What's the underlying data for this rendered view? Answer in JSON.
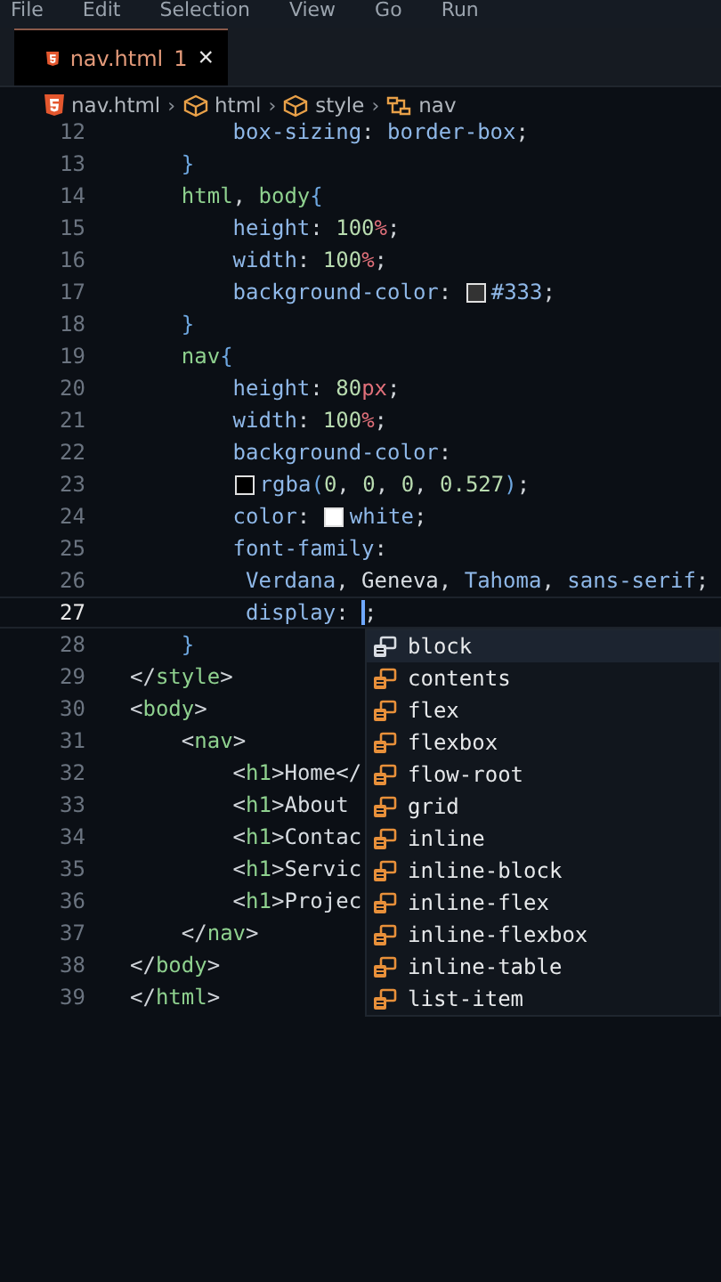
{
  "menu": [
    "File",
    "Edit",
    "Selection",
    "View",
    "Go",
    "Run"
  ],
  "tab": {
    "name": "nav.html",
    "problems": "1",
    "close": "×"
  },
  "breadcrumb_separator": "›",
  "breadcrumb": [
    {
      "label": "nav.html",
      "kind": "file"
    },
    {
      "label": "html",
      "kind": "element"
    },
    {
      "label": "style",
      "kind": "element"
    },
    {
      "label": "nav",
      "kind": "selector"
    }
  ],
  "code_lines": [
    {
      "number": "12",
      "current": false,
      "tokens": [
        {
          "text": "        box-sizing",
          "kind": "prop"
        },
        {
          "text": ": ",
          "kind": "punct"
        },
        {
          "text": "border-box",
          "kind": "value"
        },
        {
          "text": ";",
          "kind": "punct"
        }
      ]
    },
    {
      "number": "13",
      "current": false,
      "tokens": [
        {
          "text": "    }",
          "kind": "bracket"
        }
      ]
    },
    {
      "number": "14",
      "current": false,
      "tokens": [
        {
          "text": "    html",
          "kind": "tag"
        },
        {
          "text": ", ",
          "kind": "punct"
        },
        {
          "text": "body",
          "kind": "tag"
        },
        {
          "text": "{",
          "kind": "bracket"
        }
      ]
    },
    {
      "number": "15",
      "current": false,
      "tokens": [
        {
          "text": "        height",
          "kind": "prop"
        },
        {
          "text": ": ",
          "kind": "punct"
        },
        {
          "text": "100",
          "kind": "num"
        },
        {
          "text": "%",
          "kind": "unit"
        },
        {
          "text": ";",
          "kind": "punct"
        }
      ]
    },
    {
      "number": "16",
      "current": false,
      "tokens": [
        {
          "text": "        width",
          "kind": "prop"
        },
        {
          "text": ": ",
          "kind": "punct"
        },
        {
          "text": "100",
          "kind": "num"
        },
        {
          "text": "%",
          "kind": "unit"
        },
        {
          "text": ";",
          "kind": "punct"
        }
      ]
    },
    {
      "number": "17",
      "current": false,
      "tokens": [
        {
          "text": "        background-color",
          "kind": "prop"
        },
        {
          "text": ": ",
          "kind": "punct"
        },
        {
          "kind": "swatch",
          "color": "#333333"
        },
        {
          "text": "#333",
          "kind": "value"
        },
        {
          "text": ";",
          "kind": "punct"
        }
      ]
    },
    {
      "number": "18",
      "current": false,
      "tokens": [
        {
          "text": "    }",
          "kind": "bracket"
        }
      ]
    },
    {
      "number": "19",
      "current": false,
      "tokens": [
        {
          "text": "    nav",
          "kind": "tag"
        },
        {
          "text": "{",
          "kind": "bracket"
        }
      ]
    },
    {
      "number": "20",
      "current": false,
      "tokens": [
        {
          "text": "        height",
          "kind": "prop"
        },
        {
          "text": ": ",
          "kind": "punct"
        },
        {
          "text": "80",
          "kind": "num"
        },
        {
          "text": "px",
          "kind": "unit"
        },
        {
          "text": ";",
          "kind": "punct"
        }
      ]
    },
    {
      "number": "21",
      "current": false,
      "tokens": [
        {
          "text": "        width",
          "kind": "prop"
        },
        {
          "text": ": ",
          "kind": "punct"
        },
        {
          "text": "100",
          "kind": "num"
        },
        {
          "text": "%",
          "kind": "unit"
        },
        {
          "text": ";",
          "kind": "punct"
        }
      ]
    },
    {
      "number": "22",
      "current": false,
      "tokens": [
        {
          "text": "        background-color",
          "kind": "prop"
        },
        {
          "text": ":",
          "kind": "punct"
        }
      ]
    },
    {
      "number": "23",
      "current": false,
      "tokens": [
        {
          "kind": "swatch",
          "color": "#000000"
        },
        {
          "text": "rgba",
          "kind": "value"
        },
        {
          "text": "(",
          "kind": "bracket"
        },
        {
          "text": "0",
          "kind": "num"
        },
        {
          "text": ", ",
          "kind": "punct"
        },
        {
          "text": "0",
          "kind": "num"
        },
        {
          "text": ", ",
          "kind": "punct"
        },
        {
          "text": "0",
          "kind": "num"
        },
        {
          "text": ", ",
          "kind": "punct"
        },
        {
          "text": "0.527",
          "kind": "num"
        },
        {
          "text": ")",
          "kind": "bracket"
        },
        {
          "text": ";",
          "kind": "punct"
        }
      ]
    },
    {
      "number": "24",
      "current": false,
      "tokens": [
        {
          "text": "        color",
          "kind": "prop"
        },
        {
          "text": ": ",
          "kind": "punct"
        },
        {
          "kind": "swatch",
          "color": "#ffffff"
        },
        {
          "text": "white",
          "kind": "value"
        },
        {
          "text": ";",
          "kind": "punct"
        }
      ]
    },
    {
      "number": "25",
      "current": false,
      "tokens": [
        {
          "text": "        font-family",
          "kind": "prop"
        },
        {
          "text": ":",
          "kind": "punct"
        }
      ]
    },
    {
      "number": "26",
      "current": false,
      "tokens": [
        {
          "text": "         Verdana",
          "kind": "value"
        },
        {
          "text": ", ",
          "kind": "punct"
        },
        {
          "text": "Geneva",
          "kind": "plain"
        },
        {
          "text": ", ",
          "kind": "punct"
        },
        {
          "text": "Tahoma",
          "kind": "value"
        },
        {
          "text": ", ",
          "kind": "punct"
        },
        {
          "text": "sans-serif",
          "kind": "value"
        },
        {
          "text": ";",
          "kind": "punct"
        }
      ]
    },
    {
      "number": "27",
      "current": true,
      "tokens": [
        {
          "text": "         display",
          "kind": "prop"
        },
        {
          "text": ": ",
          "kind": "punct"
        },
        {
          "kind": "caret"
        },
        {
          "text": ";",
          "kind": "punct"
        }
      ]
    },
    {
      "number": "28",
      "current": false,
      "tokens": [
        {
          "text": "    }",
          "kind": "bracket"
        }
      ]
    },
    {
      "number": "29",
      "current": false,
      "tokens": [
        {
          "text": "</",
          "kind": "punct"
        },
        {
          "text": "style",
          "kind": "tag"
        },
        {
          "text": ">",
          "kind": "punct"
        }
      ]
    },
    {
      "number": "30",
      "current": false,
      "tokens": [
        {
          "text": "<",
          "kind": "punct"
        },
        {
          "text": "body",
          "kind": "tag"
        },
        {
          "text": ">",
          "kind": "punct"
        }
      ]
    },
    {
      "number": "31",
      "current": false,
      "tokens": [
        {
          "text": "    <",
          "kind": "punct"
        },
        {
          "text": "nav",
          "kind": "tag"
        },
        {
          "text": ">",
          "kind": "punct"
        }
      ]
    },
    {
      "number": "32",
      "current": false,
      "tokens": [
        {
          "text": "        <",
          "kind": "punct"
        },
        {
          "text": "h1",
          "kind": "tag"
        },
        {
          "text": ">",
          "kind": "punct"
        },
        {
          "text": "Home</",
          "kind": "plain"
        }
      ]
    },
    {
      "number": "33",
      "current": false,
      "tokens": [
        {
          "text": "        <",
          "kind": "punct"
        },
        {
          "text": "h1",
          "kind": "tag"
        },
        {
          "text": ">",
          "kind": "punct"
        },
        {
          "text": "About",
          "kind": "plain"
        }
      ]
    },
    {
      "number": "34",
      "current": false,
      "tokens": [
        {
          "text": "        <",
          "kind": "punct"
        },
        {
          "text": "h1",
          "kind": "tag"
        },
        {
          "text": ">",
          "kind": "punct"
        },
        {
          "text": "Contac",
          "kind": "plain"
        }
      ]
    },
    {
      "number": "35",
      "current": false,
      "tokens": [
        {
          "text": "        <",
          "kind": "punct"
        },
        {
          "text": "h1",
          "kind": "tag"
        },
        {
          "text": ">",
          "kind": "punct"
        },
        {
          "text": "Servic",
          "kind": "plain"
        }
      ]
    },
    {
      "number": "36",
      "current": false,
      "tokens": [
        {
          "text": "        <",
          "kind": "punct"
        },
        {
          "text": "h1",
          "kind": "tag"
        },
        {
          "text": ">",
          "kind": "punct"
        },
        {
          "text": "Projec",
          "kind": "plain"
        }
      ]
    },
    {
      "number": "37",
      "current": false,
      "tokens": [
        {
          "text": "    </",
          "kind": "punct"
        },
        {
          "text": "nav",
          "kind": "tag"
        },
        {
          "text": ">",
          "kind": "punct"
        }
      ]
    },
    {
      "number": "38",
      "current": false,
      "tokens": [
        {
          "text": "</",
          "kind": "punct"
        },
        {
          "text": "body",
          "kind": "tag"
        },
        {
          "text": ">",
          "kind": "punct"
        }
      ]
    },
    {
      "number": "39",
      "current": false,
      "tokens": [
        {
          "text": "</",
          "kind": "punct"
        },
        {
          "text": "html",
          "kind": "tag"
        },
        {
          "text": ">",
          "kind": "punct"
        }
      ]
    }
  ],
  "suggestions": [
    {
      "label": "block",
      "selected": true
    },
    {
      "label": "contents",
      "selected": false
    },
    {
      "label": "flex",
      "selected": false
    },
    {
      "label": "flexbox",
      "selected": false
    },
    {
      "label": "flow-root",
      "selected": false
    },
    {
      "label": "grid",
      "selected": false
    },
    {
      "label": "inline",
      "selected": false
    },
    {
      "label": "inline-block",
      "selected": false
    },
    {
      "label": "inline-flex",
      "selected": false
    },
    {
      "label": "inline-flexbox",
      "selected": false
    },
    {
      "label": "inline-table",
      "selected": false
    },
    {
      "label": "list-item",
      "selected": false
    }
  ]
}
